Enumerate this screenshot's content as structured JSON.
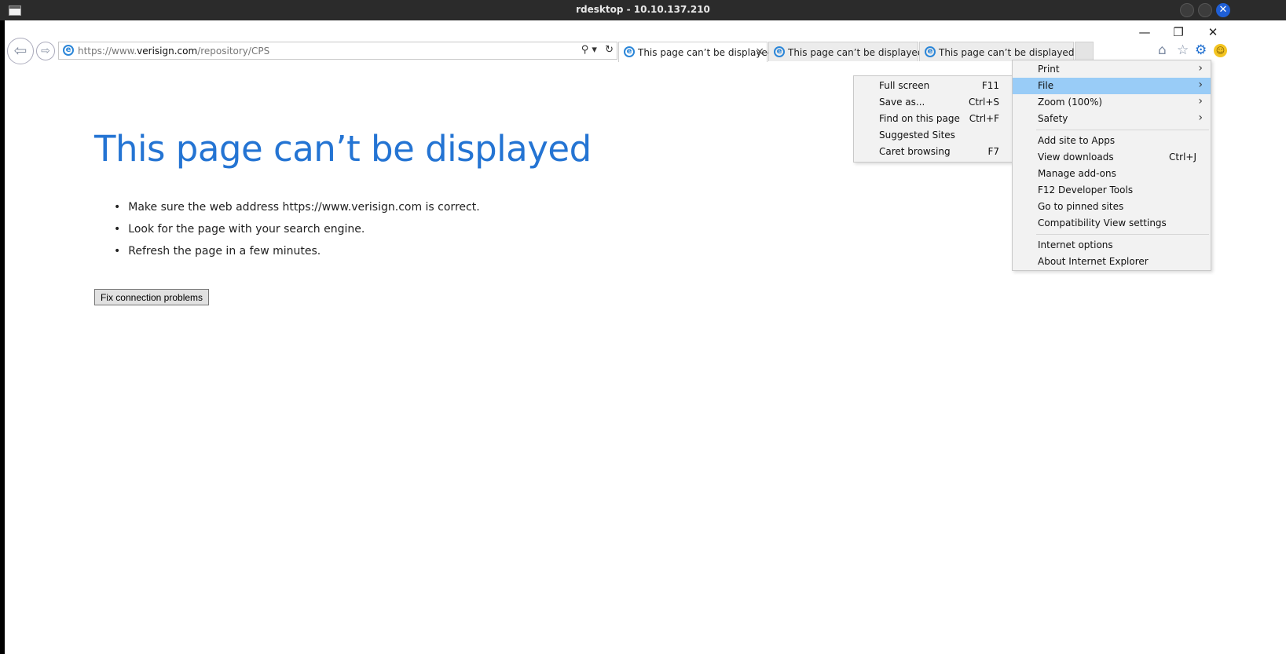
{
  "rdesktop": {
    "title": "rdesktop - 10.10.137.210",
    "close_glyph": "✕"
  },
  "window": {
    "minimize": "—",
    "restore": "❐",
    "close": "✕"
  },
  "nav": {
    "back": "⇦",
    "forward": "⇨"
  },
  "address": {
    "url_prefix": "https://www.",
    "url_domain": "verisign.com",
    "url_path": "/repository/CPS",
    "search_glyph": "⚲ ▾",
    "refresh_glyph": "↻"
  },
  "tabs": [
    {
      "title": "This page can’t be displayed",
      "close": "×"
    },
    {
      "title": "This page can’t be displayed"
    },
    {
      "title": "This page can’t be displayed"
    }
  ],
  "toolbar_icons": {
    "home": "⌂",
    "favorites": "☆",
    "tools": "⚙",
    "feedback": "☺"
  },
  "page": {
    "heading": "This page can’t be displayed",
    "bullets": [
      "Make sure the web address https://www.verisign.com is correct.",
      "Look for the page with your search engine.",
      "Refresh the page in a few minutes."
    ],
    "fix_button": "Fix connection problems"
  },
  "file_submenu": [
    {
      "label": "Full screen",
      "shortcut": "F11"
    },
    {
      "label": "Save as...",
      "shortcut": "Ctrl+S"
    },
    {
      "label": "Find on this page",
      "shortcut": "Ctrl+F"
    },
    {
      "label": "Suggested Sites",
      "shortcut": ""
    },
    {
      "label": "Caret browsing",
      "shortcut": "F7"
    }
  ],
  "tools_menu": {
    "arrow": "›",
    "group1": [
      {
        "label": "Print"
      },
      {
        "label": "File"
      },
      {
        "label": "Zoom (100%)"
      },
      {
        "label": "Safety"
      }
    ],
    "group2": [
      {
        "label": "Add site to Apps",
        "shortcut": ""
      },
      {
        "label": "View downloads",
        "shortcut": "Ctrl+J"
      },
      {
        "label": "Manage add-ons",
        "shortcut": ""
      },
      {
        "label": "F12 Developer Tools",
        "shortcut": ""
      },
      {
        "label": "Go to pinned sites",
        "shortcut": ""
      },
      {
        "label": "Compatibility View settings",
        "shortcut": ""
      }
    ],
    "group3": [
      {
        "label": "Internet options"
      },
      {
        "label": "About Internet Explorer"
      }
    ]
  }
}
